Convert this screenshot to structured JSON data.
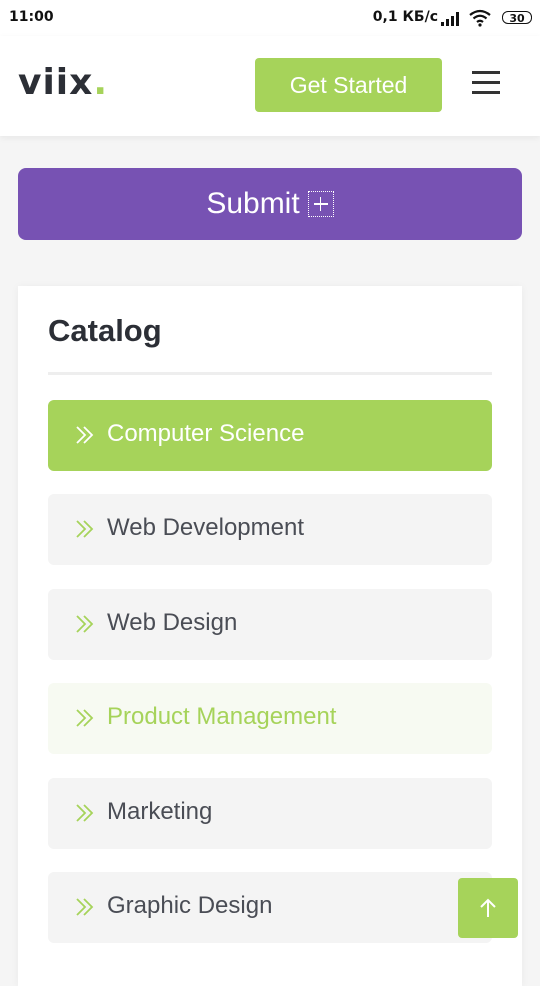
{
  "status_bar": {
    "time": "11:00",
    "network_speed": "0,1 КБ/с",
    "battery": "30",
    "signal_icon": "signal-icon",
    "wifi_icon": "wifi-icon"
  },
  "header": {
    "logo_text": "viix",
    "logo_dot": ".",
    "get_started_label": "Get Started",
    "menu_icon": "hamburger-menu-icon"
  },
  "submit": {
    "label": "Submit",
    "icon": "plus-box-icon"
  },
  "catalog": {
    "title": "Catalog",
    "items": [
      {
        "label": "Computer Science",
        "state": "active"
      },
      {
        "label": "Web Development",
        "state": "default"
      },
      {
        "label": "Web Design",
        "state": "default"
      },
      {
        "label": "Product Management",
        "state": "hover"
      },
      {
        "label": "Marketing",
        "state": "default"
      },
      {
        "label": "Graphic Design",
        "state": "default"
      }
    ]
  },
  "scroll_top": {
    "icon": "arrow-up-icon"
  },
  "colors": {
    "accent_green": "#a6d35a",
    "submit_purple": "#7752b3",
    "text_dark": "#2c2f36",
    "item_bg": "#f4f4f4"
  }
}
